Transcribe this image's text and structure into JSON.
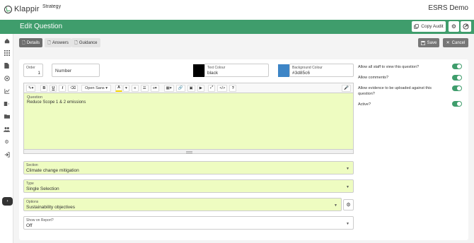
{
  "app": {
    "logo_text": "Klappir",
    "product": "Strategy",
    "title": "ESRS Demo"
  },
  "header": {
    "title": "Edit Question",
    "copy_audit_label": "Copy Audit"
  },
  "tabs": [
    {
      "label": "Details",
      "active": true
    },
    {
      "label": "Answers",
      "active": false
    },
    {
      "label": "Guidance",
      "active": false
    }
  ],
  "actions": {
    "save_label": "Save",
    "cancel_label": "Cancel"
  },
  "form": {
    "order": {
      "label": "Order",
      "value": "1"
    },
    "number": {
      "placeholder": "Number"
    },
    "text_colour": {
      "label": "Text Colour",
      "value": "black",
      "swatch": "#000000"
    },
    "background_colour": {
      "label": "Background Colour",
      "value": "#3d85c6",
      "swatch": "#3d85c6"
    },
    "question": {
      "label": "Question",
      "value": "Reduce Scope 1 & 2 emissions"
    },
    "section": {
      "label": "Section",
      "value": "Climate change mitigation"
    },
    "type": {
      "label": "Type",
      "value": "Single Selection"
    },
    "options": {
      "label": "Options",
      "value": "Sustainability objectives"
    },
    "show_on_report": {
      "label": "Show on Report?",
      "value": "Off"
    }
  },
  "editor_toolbar": {
    "font_name": "Open Sans"
  },
  "toggles": [
    {
      "label": "Allow all staff to view this question?",
      "on": true
    },
    {
      "label": "Allow comments?",
      "on": true
    },
    {
      "label": "Allow evidence to be uploaded against this question?",
      "on": true
    },
    {
      "label": "Active?",
      "on": true
    }
  ],
  "colors": {
    "brand_green": "#3f9d6c",
    "field_highlight": "#eefcc1"
  }
}
